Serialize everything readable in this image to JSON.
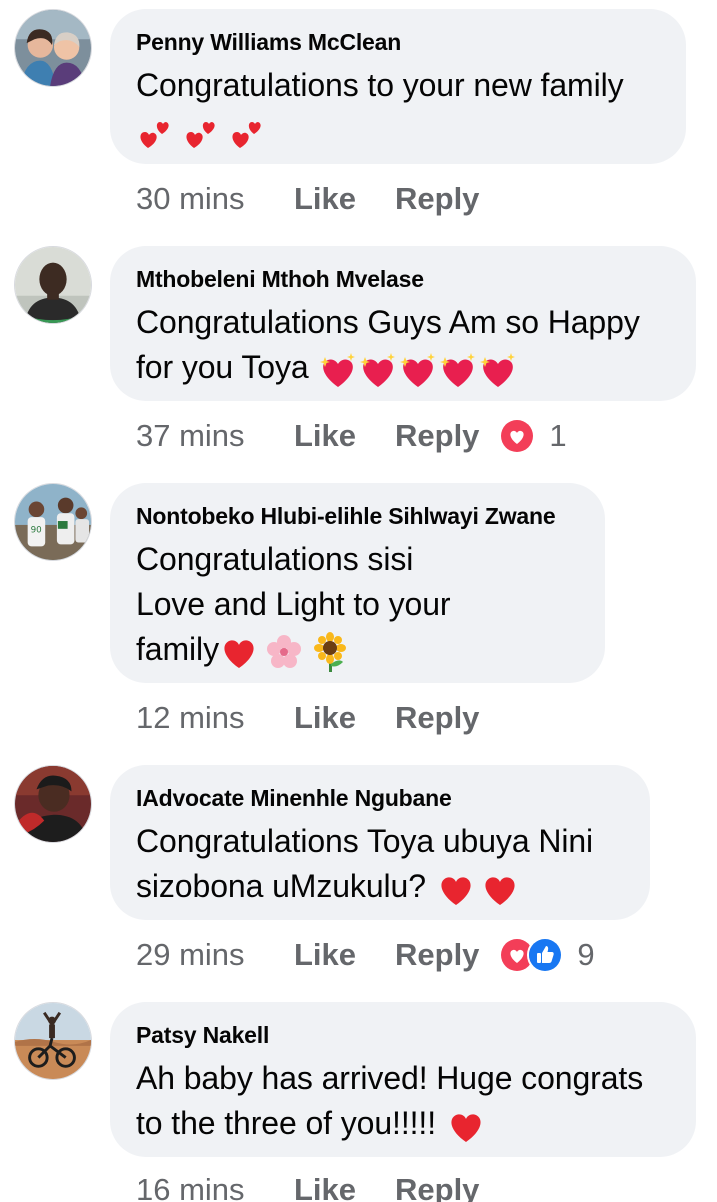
{
  "comments": [
    {
      "author": "Penny Williams McClean",
      "lines": [
        "Congratulations to your new family",
        ""
      ],
      "emoji_line": [
        "two-hearts",
        "two-hearts",
        "two-hearts"
      ],
      "time": "30 mins",
      "like_label": "Like",
      "reply_label": "Reply",
      "avatar_icon": "profile-photo-two-women"
    },
    {
      "author": "Mthobeleni Mthoh Mvelase",
      "lines": [
        "Congratulations Guys Am so Happy",
        "for you Toya"
      ],
      "emoji_line": [
        "sparkling-heart",
        "sparkling-heart",
        "sparkling-heart",
        "sparkling-heart",
        "sparkling-heart"
      ],
      "time": "37 mins",
      "like_label": "Like",
      "reply_label": "Reply",
      "reactions": [
        "love-reaction"
      ],
      "reaction_count": "1",
      "avatar_icon": "profile-photo-man"
    },
    {
      "author": "Nontobeko Hlubi-elihle Sihlwayi Zwane",
      "lines": [
        "Congratulations sisi",
        "Love and Light to your",
        "family"
      ],
      "emoji_line": [
        "red-heart",
        "cherry-blossom",
        "sunflower"
      ],
      "time": "12 mins",
      "like_label": "Like",
      "reply_label": "Reply",
      "avatar_icon": "profile-photo-group"
    },
    {
      "author": "IAdvocate Minenhle Ngubane",
      "lines": [
        "Congratulations Toya ubuya Nini",
        "sizobona uMzukulu?"
      ],
      "emoji_line": [
        "red-heart",
        "red-heart"
      ],
      "time": "29 mins",
      "like_label": "Like",
      "reply_label": "Reply",
      "reactions": [
        "love-reaction",
        "like-reaction"
      ],
      "reaction_count": "9",
      "avatar_icon": "profile-photo-woman"
    },
    {
      "author": "Patsy Nakell",
      "lines": [
        "Ah baby has arrived! Huge congrats",
        "to the three of you!!!!!"
      ],
      "emoji_line": [
        "red-heart"
      ],
      "time": "16 mins",
      "like_label": "Like",
      "reply_label": "Reply",
      "avatar_icon": "profile-photo-cyclist"
    }
  ],
  "colors": {
    "bubble": "#f0f2f5",
    "text": "#050505",
    "meta": "#65676b",
    "love": "#f33e58",
    "like": "#1877f2"
  }
}
